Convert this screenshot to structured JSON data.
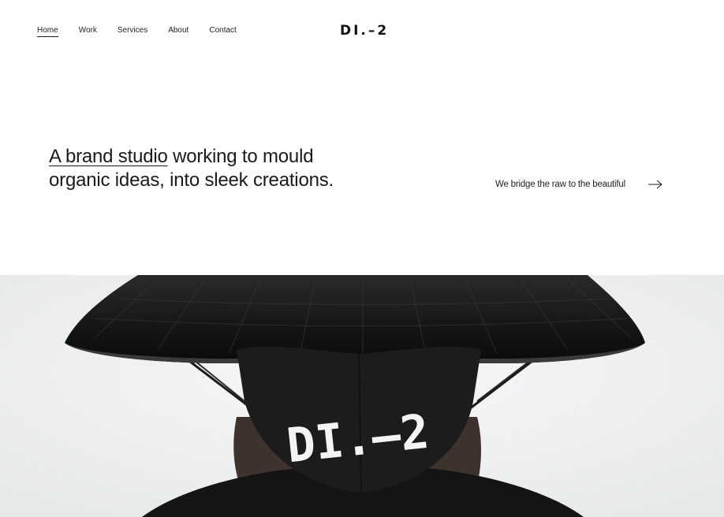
{
  "nav": {
    "items": [
      {
        "label": "Home",
        "active": true
      },
      {
        "label": "Work",
        "active": false
      },
      {
        "label": "Services",
        "active": false
      },
      {
        "label": "About",
        "active": false
      },
      {
        "label": "Contact",
        "active": false
      }
    ]
  },
  "logo": {
    "text": "DI.–2"
  },
  "hero": {
    "highlight": "A brand studio",
    "rest_line1": " working to mould",
    "line2": "organic ideas, into sleek creations."
  },
  "tagline": {
    "text": "We bridge the raw to the beautiful",
    "icon": "arrow-right-icon"
  },
  "photo": {
    "mask_text": "DI.–2",
    "colors": {
      "background": "#eef0f1",
      "hat": "#1b1b1b",
      "mask": "#1c1c1c",
      "skin": "#6b4a3a",
      "print": "#f4f4f4"
    }
  }
}
